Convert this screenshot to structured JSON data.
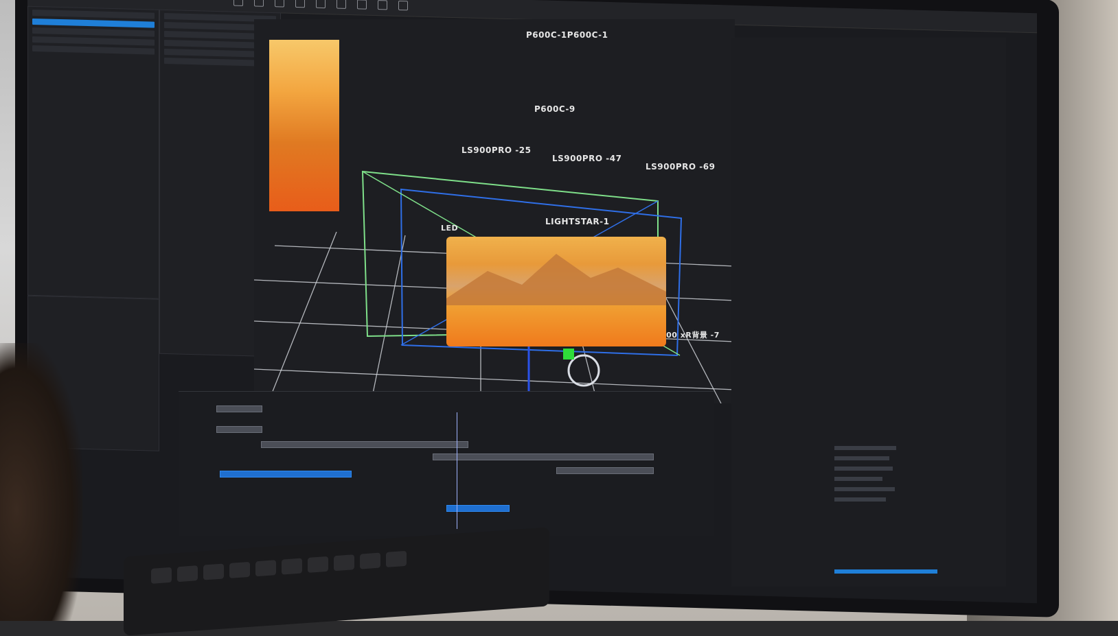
{
  "scene": {
    "description_labels": {
      "top_center": "P600C-1P600C-1",
      "mid_center": "P600C-9",
      "left_ls": "LS900PRO -25",
      "center_ls": "LS900PRO -47",
      "right_ls": "LS900PRO -69",
      "lightstar": "LIGHTSTAR-1",
      "led": "LED",
      "bottom_right": "透视投射 -C300 xR背景 -7"
    }
  },
  "colors": {
    "selection_blue": "#1f7fd8",
    "frustum_green": "#7fe08a",
    "frustum_blue": "#2f6fe8",
    "screen_orange": "#f0a234",
    "axis_red": "#e02a2a",
    "axis_green": "#2fdc3a",
    "axis_blue": "#2a52e8"
  },
  "icons": [
    "toolbar-icons",
    "gizmo-rotate-icon",
    "gizmo-translate-icon"
  ]
}
